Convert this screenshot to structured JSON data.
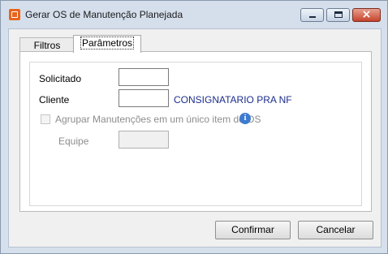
{
  "window": {
    "title": "Gerar OS de Manutenção Planejada"
  },
  "title_buttons": {
    "close_glyph": "×"
  },
  "tabs": [
    {
      "label": "Filtros"
    },
    {
      "label": "Parâmetros"
    }
  ],
  "form": {
    "solicitado_label": "Solicitado",
    "solicitado_value": "",
    "cliente_label": "Cliente",
    "cliente_value": "",
    "cliente_name": "CONSIGNATARIO PRA NF",
    "agrupar_label": "Agrupar Manutenções em um único item de OS",
    "agrupar_checked": false,
    "info_glyph": "i",
    "equipe_label": "Equipe",
    "equipe_value": ""
  },
  "buttons": {
    "confirm_label": "Confirmar",
    "cancel_label": "Cancelar"
  },
  "colors": {
    "client_name": "#1c2d8c",
    "info_icon": "#3d7bd0",
    "close_button": "#c7432b"
  }
}
